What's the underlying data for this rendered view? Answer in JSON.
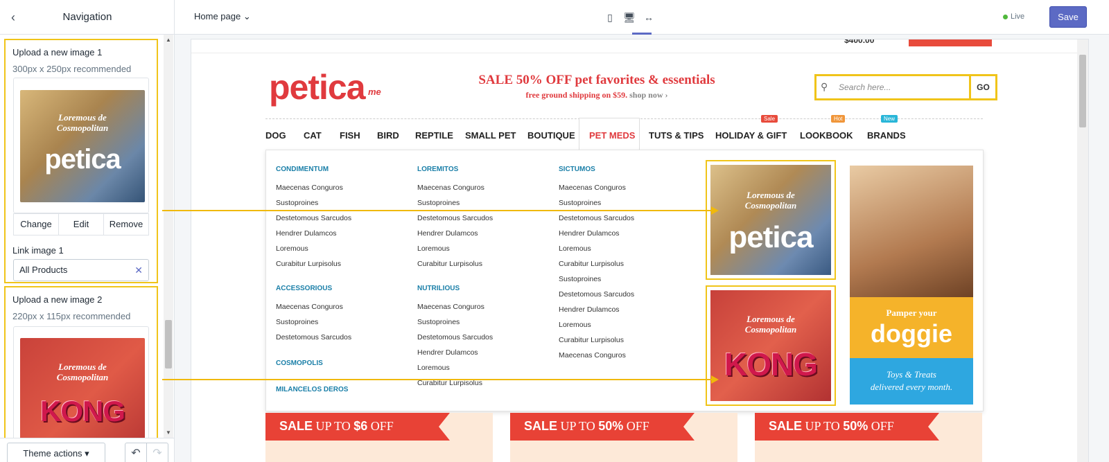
{
  "sidebar": {
    "title": "Navigation",
    "section1": {
      "title": "Upload a new image 1",
      "recommended": "300px x 250px recommended",
      "actions": [
        "Change",
        "Edit",
        "Remove"
      ],
      "link_label": "Link image 1",
      "link_value": "All Products"
    },
    "section2": {
      "title": "Upload a new image 2",
      "recommended": "220px x 115px recommended"
    },
    "footer": {
      "theme_actions": "Theme actions"
    }
  },
  "topbar": {
    "page_select": "Home page",
    "live": "Live",
    "save": "Save"
  },
  "preview": {
    "top_price": "$400.00",
    "logo": "petica",
    "logo_suffix": "me",
    "sale_headline": "SALE 50% OFF pet favorites & essentials",
    "sale_sub": "free ground shipping on $59.",
    "sale_link": "shop now ›",
    "search_placeholder": "Search here...",
    "search_go": "GO",
    "nav": [
      "DOG",
      "CAT",
      "FISH",
      "BIRD",
      "REPTILE",
      "SMALL PET",
      "BOUTIQUE",
      "PET MEDS",
      "TUTS & TIPS",
      "HOLIDAY & GIFT",
      "LOOKBOOK",
      "BRANDS"
    ],
    "nav_tags": {
      "sale": "Sale",
      "hot": "Hot",
      "new": "New"
    },
    "mega": {
      "col1": {
        "groups": [
          {
            "title": "CONDIMENTUM",
            "items": [
              "Maecenas Conguros",
              "Sustoproines",
              "Destetomous Sarcudos",
              "Hendrer Dulamcos",
              "Loremous",
              "Curabitur Lurpisolus"
            ]
          },
          {
            "title": "ACCESSORIOUS",
            "items": [
              "Maecenas Conguros",
              "Sustoproines",
              "Destetomous Sarcudos"
            ]
          },
          {
            "title": "COSMOPOLIS",
            "items": []
          },
          {
            "title": "MILANCELOS DEROS",
            "items": []
          }
        ]
      },
      "col2": {
        "groups": [
          {
            "title": "LOREMITOS",
            "items": [
              "Maecenas Conguros",
              "Sustoproines",
              "Destetomous Sarcudos",
              "Hendrer Dulamcos",
              "Loremous",
              "Curabitur Lurpisolus"
            ]
          },
          {
            "title": "NUTRILIOUS",
            "items": [
              "Maecenas Conguros",
              "Sustoproines",
              "Destetomous Sarcudos",
              "Hendrer Dulamcos",
              "Loremous",
              "Curabitur Lurpisolus"
            ]
          }
        ]
      },
      "col3": {
        "groups": [
          {
            "title": "SICTUMOS",
            "items": [
              "Maecenas Conguros",
              "Sustoproines",
              "Destetomous Sarcudos",
              "Hendrer Dulamcos",
              "Loremous",
              "Curabitur Lurpisolus",
              "Sustoproines",
              "Destetomous Sarcudos",
              "Hendrer Dulamcos",
              "Loremous",
              "Curabitur Lurpisolus",
              "Maecenas Conguros"
            ]
          }
        ]
      },
      "promo_text_1": "Loremous de",
      "promo_text_2": "Cosmopolitan",
      "promo1_brand": "petica",
      "promo2_brand": "KONG",
      "doggie": {
        "line1": "Pamper your",
        "line2": "doggie",
        "line3": "Toys & Treats",
        "line4": "delivered every month."
      }
    },
    "sale_cards": [
      {
        "prefix": "SALE",
        "text": "UP TO",
        "amount": "$6",
        "suffix": "OFF"
      },
      {
        "prefix": "SALE",
        "text": "UP TO",
        "amount": "50%",
        "suffix": "OFF"
      },
      {
        "prefix": "SALE",
        "text": "UP TO",
        "amount": "50%",
        "suffix": "OFF"
      }
    ]
  },
  "colors": {
    "highlight": "#f0c419",
    "brand_red": "#e03a3e",
    "accent": "#5c6ac4",
    "link_blue": "#1a7fa8"
  }
}
